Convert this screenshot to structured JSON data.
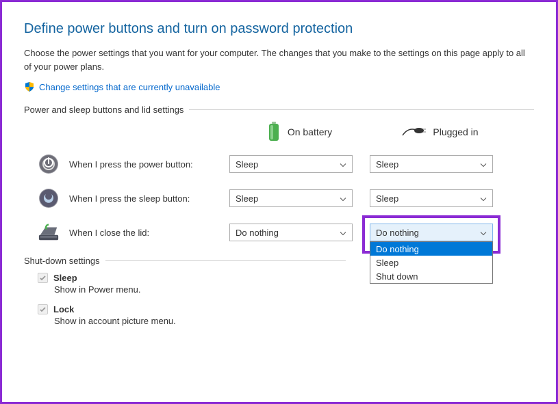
{
  "title": "Define power buttons and turn on password protection",
  "intro": "Choose the power settings that you want for your computer. The changes that you make to the settings on this page apply to all of your power plans.",
  "admin_link": "Change settings that are currently unavailable",
  "section1_label": "Power and sleep buttons and lid settings",
  "columns": {
    "battery": "On battery",
    "plugged": "Plugged in"
  },
  "rows": {
    "power_btn": {
      "label": "When I press the power button:",
      "battery": "Sleep",
      "plugged": "Sleep"
    },
    "sleep_btn": {
      "label": "When I press the sleep button:",
      "battery": "Sleep",
      "plugged": "Sleep"
    },
    "lid": {
      "label": "When I close the lid:",
      "battery": "Do nothing",
      "plugged": "Do nothing"
    }
  },
  "lid_plugged_options": [
    "Do nothing",
    "Sleep",
    "Shut down"
  ],
  "section2_label": "Shut-down settings",
  "shutdown": {
    "sleep": {
      "label": "Sleep",
      "desc": "Show in Power menu."
    },
    "lock": {
      "label": "Lock",
      "desc": "Show in account picture menu."
    }
  }
}
